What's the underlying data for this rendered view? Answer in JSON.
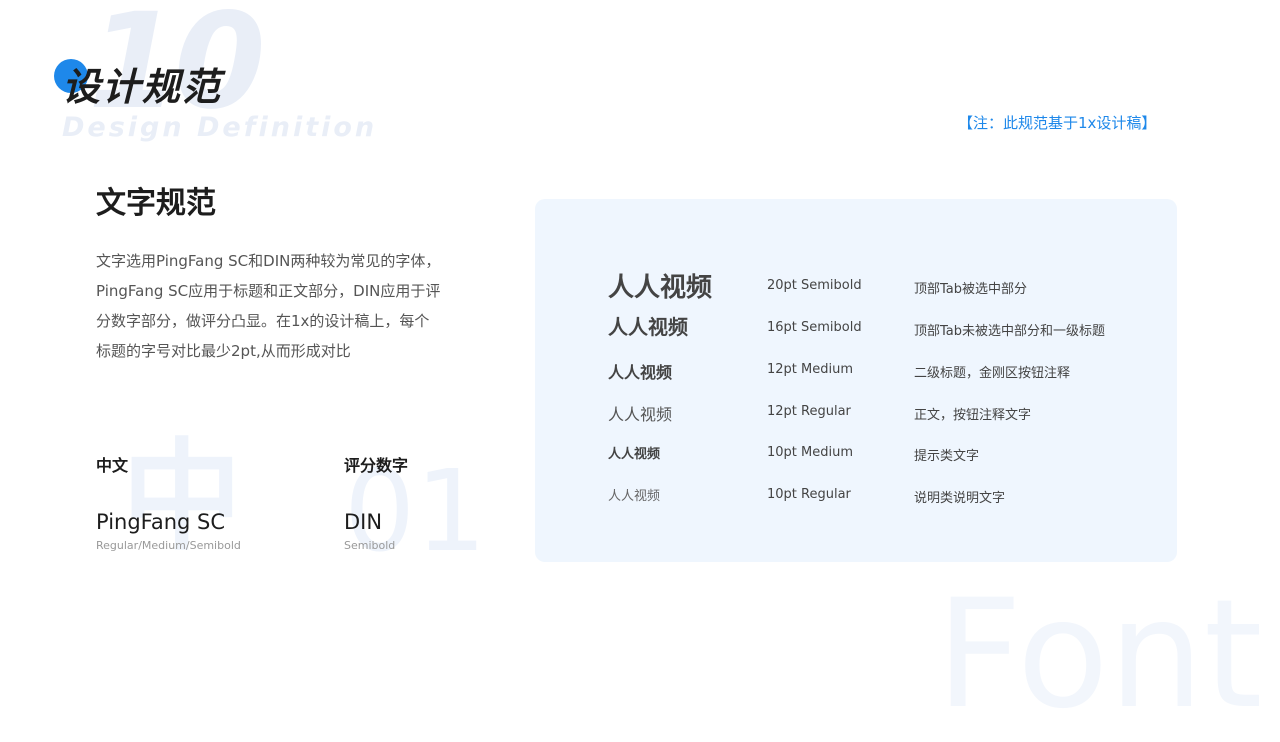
{
  "header": {
    "bg_number": "10",
    "subtitle": "Design Definition",
    "title": "设计规范",
    "note": "【注：此规范基于1x设计稿】"
  },
  "section": {
    "title": "文字规范",
    "desc_lines": [
      "文字选用PingFang SC和DIN两种较为常见的字体，",
      "PingFang SC应用于标题和正文部分，DIN应用于评",
      "分数字部分，做评分凸显。在1x的设计稿上，每个",
      "标题的字号对比最少2pt,从而形成对比"
    ]
  },
  "fonts": [
    {
      "label": "中文",
      "watermark": "中",
      "name": "PingFang SC",
      "weights": "Regular/Medium/Semibold"
    },
    {
      "label": "评分数字",
      "watermark": "01",
      "name": "DIN",
      "weights": "Semibold"
    }
  ],
  "bg_font_word": "Font",
  "specs": [
    {
      "sample": "人人视频",
      "spec": "20pt Semibold",
      "usage": "顶部Tab被选中部分"
    },
    {
      "sample": "人人视频",
      "spec": "16pt Semibold",
      "usage": "顶部Tab未被选中部分和一级标题"
    },
    {
      "sample": "人人视频",
      "spec": "12pt Medium",
      "usage": "二级标题，金刚区按钮注释"
    },
    {
      "sample": "人人视频",
      "spec": "12pt Regular",
      "usage": "正文，按钮注释文字"
    },
    {
      "sample": "人人视频",
      "spec": "10pt Medium",
      "usage": "提示类文字"
    },
    {
      "sample": "人人视频",
      "spec": "10pt Regular",
      "usage": "说明类说明文字"
    }
  ],
  "colors": {
    "accent": "#1e88ea",
    "panel_bg": "#eff6fe",
    "text_dark": "#1d1d1d",
    "text_body": "#555555"
  }
}
